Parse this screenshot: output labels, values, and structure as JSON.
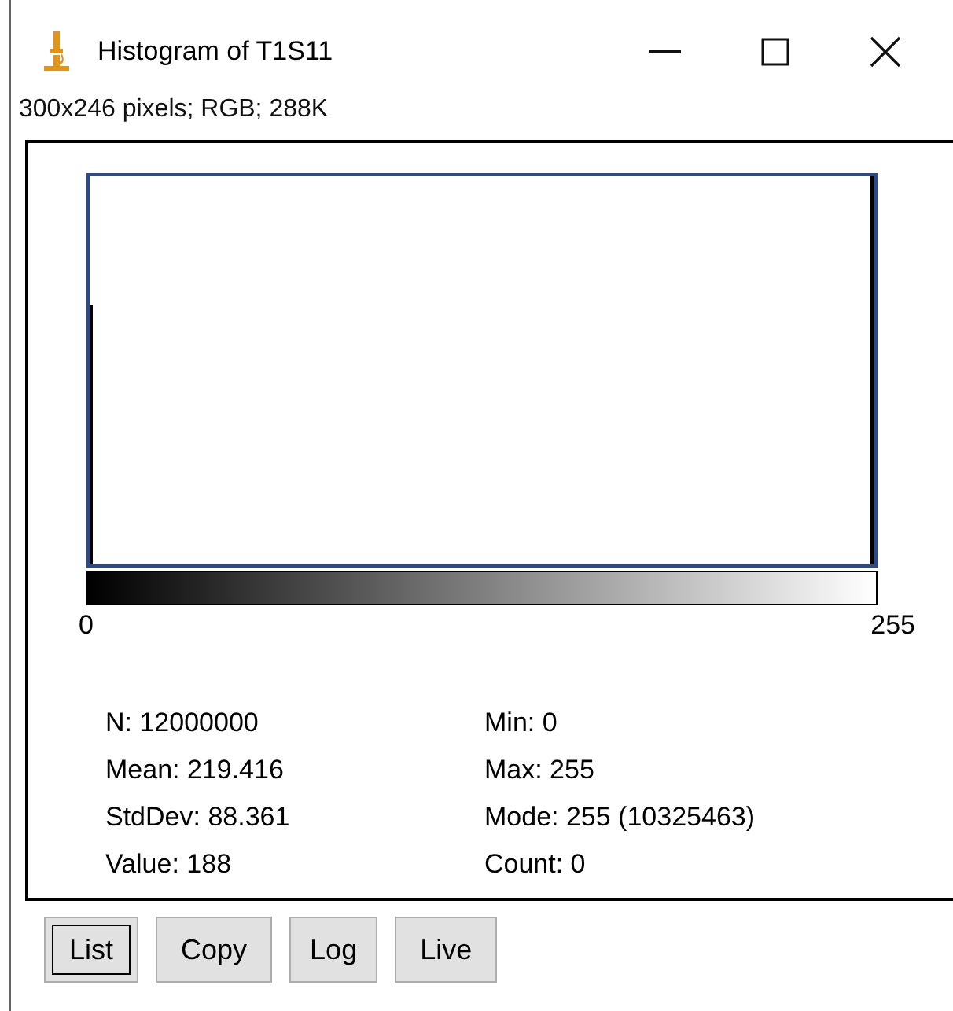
{
  "window": {
    "title": "Histogram of T1S11",
    "controls": [
      {
        "kind": "minimize"
      },
      {
        "kind": "maximize"
      },
      {
        "kind": "close"
      }
    ]
  },
  "info": "300x246 pixels; RGB; 288K",
  "histogram": {
    "axis_min": "0",
    "axis_max": "255"
  },
  "stats": {
    "left": [
      "N: 12000000",
      "Mean: 219.416",
      "StdDev: 88.361",
      "Value: 188"
    ],
    "right": [
      "Min: 0",
      "Max: 255",
      "Mode: 255 (10325463)",
      "Count: 0"
    ]
  },
  "buttons": [
    {
      "label": "List",
      "focused": true
    },
    {
      "label": "Copy",
      "focused": false
    },
    {
      "label": "Log",
      "focused": false
    },
    {
      "label": "Live",
      "focused": false
    }
  ]
}
